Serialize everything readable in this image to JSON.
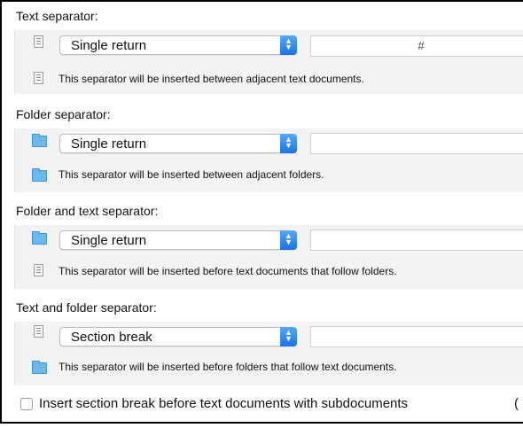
{
  "sections": [
    {
      "title": "Text separator:",
      "row_icon": "document-icon",
      "select_value": "Single return",
      "field_value": "#",
      "desc_icon": "document-icon",
      "description": "This separator will be inserted between adjacent text documents."
    },
    {
      "title": "Folder separator:",
      "row_icon": "folder-icon",
      "select_value": "Single return",
      "field_value": "",
      "desc_icon": "folder-icon",
      "description": "This separator will be inserted between adjacent folders."
    },
    {
      "title": "Folder and text separator:",
      "row_icon": "folder-icon",
      "select_value": "Single return",
      "field_value": "",
      "desc_icon": "document-icon",
      "description": "This separator will be inserted before text documents that follow folders."
    },
    {
      "title": "Text and folder separator:",
      "row_icon": "document-icon",
      "select_value": "Section break",
      "field_value": "",
      "desc_icon": "folder-icon",
      "description": "This separator will be inserted before folders that follow text documents."
    }
  ],
  "checkbox": {
    "label": "Insert section break before text documents with subdocuments",
    "checked": false,
    "trailing": "("
  },
  "colors": {
    "panel_bg": "#f3f3f3",
    "stepper_blue": "#1d73e2",
    "folder_blue": "#6fb9ea"
  }
}
